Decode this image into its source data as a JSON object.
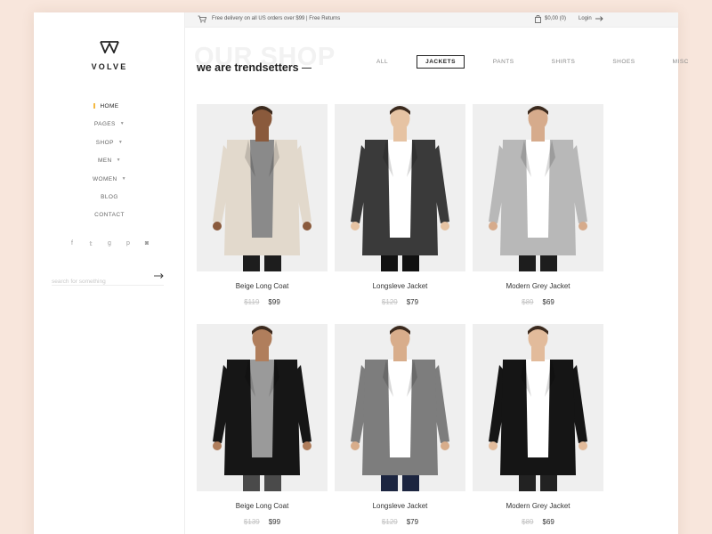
{
  "brand": {
    "name": "VOLVE"
  },
  "nav": [
    {
      "label": "HOME",
      "active": true,
      "dropdown": false
    },
    {
      "label": "PAGES",
      "active": false,
      "dropdown": true
    },
    {
      "label": "SHOP",
      "active": false,
      "dropdown": true
    },
    {
      "label": "MEN",
      "active": false,
      "dropdown": true
    },
    {
      "label": "WOMEN",
      "active": false,
      "dropdown": true
    },
    {
      "label": "BLOG",
      "active": false,
      "dropdown": false
    },
    {
      "label": "CONTACT",
      "active": false,
      "dropdown": false
    }
  ],
  "social": [
    {
      "icon": "facebook-icon",
      "glyph": "f"
    },
    {
      "icon": "twitter-icon",
      "glyph": "𝕥"
    },
    {
      "icon": "google-plus-icon",
      "glyph": "g"
    },
    {
      "icon": "pinterest-icon",
      "glyph": "p"
    },
    {
      "icon": "instagram-icon",
      "glyph": "◙"
    }
  ],
  "search": {
    "placeholder": "search for something"
  },
  "topbar": {
    "promo": "Free delivery on all US orders over $99 | Free Returns",
    "cart": "$0,00 (0)",
    "login": "Login"
  },
  "heading": {
    "ghost": "OUR SHOP",
    "tagline": "we are trendsetters"
  },
  "filters": [
    {
      "label": "ALL",
      "active": false
    },
    {
      "label": "JACKETS",
      "active": true
    },
    {
      "label": "PANTS",
      "active": false
    },
    {
      "label": "SHIRTS",
      "active": false
    },
    {
      "label": "SHOES",
      "active": false
    },
    {
      "label": "MISC",
      "active": false
    }
  ],
  "products": [
    {
      "name": "Beige Long Coat",
      "old_price": "$119",
      "price": "$99",
      "coat": "#e2d9cc",
      "inner": "#8a8a8a",
      "skin": "#8a5a3c",
      "pants": "#1d1d1d",
      "open": true
    },
    {
      "name": "Longsleve Jacket",
      "old_price": "$129",
      "price": "$79",
      "coat": "#3a3a3a",
      "inner": "#ffffff",
      "skin": "#e6c3a3",
      "pants": "#111111",
      "open": true
    },
    {
      "name": "Modern Grey Jacket",
      "old_price": "$89",
      "price": "$69",
      "coat": "#b8b8b8",
      "inner": "#ffffff",
      "skin": "#d6ab8c",
      "pants": "#1d1d1d",
      "open": true
    },
    {
      "name": "Beige Long Coat",
      "old_price": "$139",
      "price": "$99",
      "coat": "#161616",
      "inner": "#9a9a9a",
      "skin": "#b07e5c",
      "pants": "#4a4a4a",
      "open": true
    },
    {
      "name": "Longsleve Jacket",
      "old_price": "$129",
      "price": "$79",
      "coat": "#7d7d7d",
      "inner": "#ffffff",
      "skin": "#d8ad8b",
      "pants": "#1c2540",
      "open": true
    },
    {
      "name": "Modern Grey Jacket",
      "old_price": "$89",
      "price": "$69",
      "coat": "#151515",
      "inner": "#ffffff",
      "skin": "#e2bb9b",
      "pants": "#222222",
      "open": true
    }
  ],
  "colors": {
    "accent": "#f4b942",
    "background": "#f8e6dc"
  }
}
